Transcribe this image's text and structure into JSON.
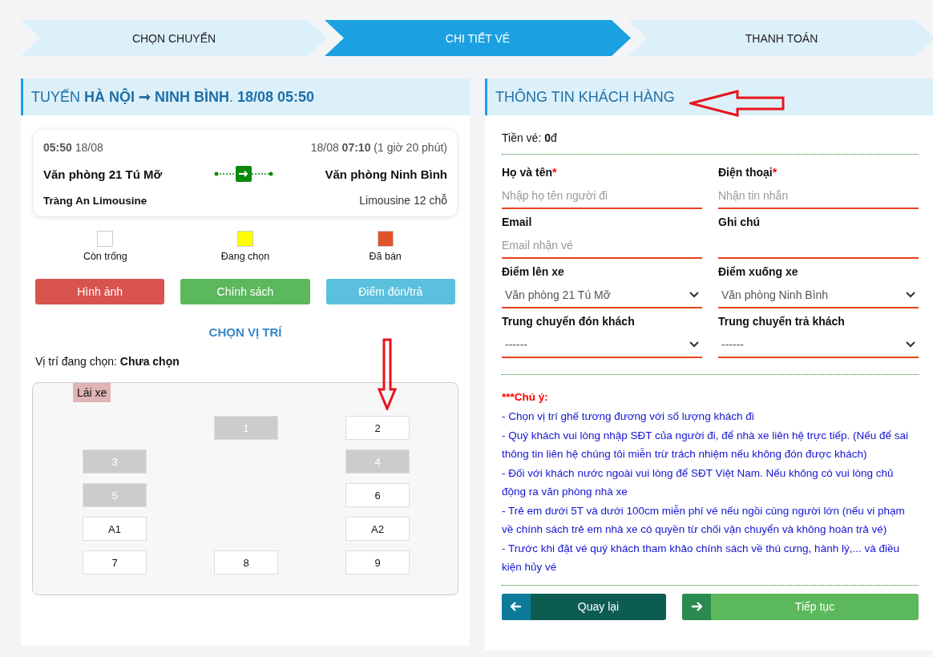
{
  "steps": [
    {
      "label": "CHỌN CHUYẾN",
      "selected": false
    },
    {
      "label": "CHI TIẾT VÉ",
      "selected": true
    },
    {
      "label": "THANH TOÁN",
      "selected": false
    }
  ],
  "trip": {
    "title": "TUYẾN **HÀ NỘI ➞ NINH BÌNH**. **18/08 05:50**",
    "departure": "**05:50** 18/08",
    "arrival": "18/08 **07:10** (1 giờ 20 phút)",
    "from": "Văn phòng 21 Tú Mỡ",
    "to": "Văn phòng Ninh Bình",
    "operator": "Tràng An Limousine",
    "vehicle": "Limousine 12 chỗ"
  },
  "legend": [
    {
      "label": "Còn trống",
      "color": "#ffffff"
    },
    {
      "label": "Đang chọn",
      "color": "#ffff00"
    },
    {
      "label": "Đã bán",
      "color": "#e0522a"
    }
  ],
  "info_buttons": [
    {
      "label": "Hình ảnh",
      "kind": "danger"
    },
    {
      "label": "Chính sách",
      "kind": "success"
    },
    {
      "label": "Điểm đón/trả",
      "kind": "info"
    }
  ],
  "seat_section": {
    "title": "CHỌN VỊ TRÍ",
    "selection": "Vị trí đang chọn: **Chưa chọn**",
    "driver": "Lái xe"
  },
  "seat_rows": [
    {
      "middle": {
        "label": "1",
        "booked": true
      },
      "right": {
        "label": "2",
        "booked": false
      }
    },
    {
      "left": {
        "label": "3",
        "booked": true
      },
      "right": {
        "label": "4",
        "booked": true
      }
    },
    {
      "left": {
        "label": "5",
        "booked": true
      },
      "right": {
        "label": "6",
        "booked": false
      }
    },
    {
      "left": {
        "label": "A1",
        "booked": false
      },
      "right": {
        "label": "A2",
        "booked": false
      }
    },
    {
      "left": {
        "label": "7",
        "booked": false
      },
      "middle": {
        "label": "8",
        "booked": false
      },
      "right": {
        "label": "9",
        "booked": false
      }
    }
  ],
  "customer": {
    "title": "THÔNG TIN KHÁCH HÀNG",
    "price": "Tiền vé: **0**đ",
    "fields": [
      {
        "label": "Họ và tên",
        "required_mark": "*",
        "kind": "input",
        "placeholder": "Nhập họ tên người đi"
      },
      {
        "label": "Điện thoại",
        "required_mark": "*",
        "kind": "input",
        "placeholder": "Nhận tin nhắn"
      },
      {
        "label": "Email",
        "kind": "input",
        "placeholder": "Email nhận vé"
      },
      {
        "label": "Ghi chú",
        "kind": "input"
      },
      {
        "label": "Điểm lên xe",
        "kind": "select",
        "value": "Văn phòng 21 Tú Mỡ"
      },
      {
        "label": "Điểm xuống xe",
        "kind": "select",
        "value": "Văn phòng Ninh Bình"
      },
      {
        "label": "Trung chuyển đón khách",
        "kind": "select",
        "value": "------"
      },
      {
        "label": "Trung chuyển trả khách",
        "kind": "select",
        "value": "------"
      }
    ],
    "notes_title": "***Chú ý:",
    "notes": [
      "- Chọn vị trí ghế tương đương với số lượng khách đi",
      "- Quý khách vui lòng nhập SĐT của người đi, để nhà xe liên hệ trực tiếp. (Nếu để sai thông tin liên hệ chúng tôi miễn trừ trách nhiệm nếu không đón được khách)",
      "- Đối với khách nước ngoài vui lòng để SĐT Việt Nam. Nếu không có vui lòng chủ động ra văn phòng nhà xe",
      "- Trẻ em dưới 5T và dưới 100cm miễn phí vé nếu ngồi cùng người lớn (nếu vi phạm về chính sách trẻ em nhà xe có quyền từ chối vận chuyển và không hoàn trả vé)",
      "- Trước khi đặt vé quý khách tham khảo chính sách về thú cưng, hành lý,... và điều kiện hủy vé"
    ],
    "actions": [
      {
        "label": "Quay lại",
        "kind": "back"
      },
      {
        "label": "Tiếp tục",
        "kind": "next"
      }
    ]
  }
}
